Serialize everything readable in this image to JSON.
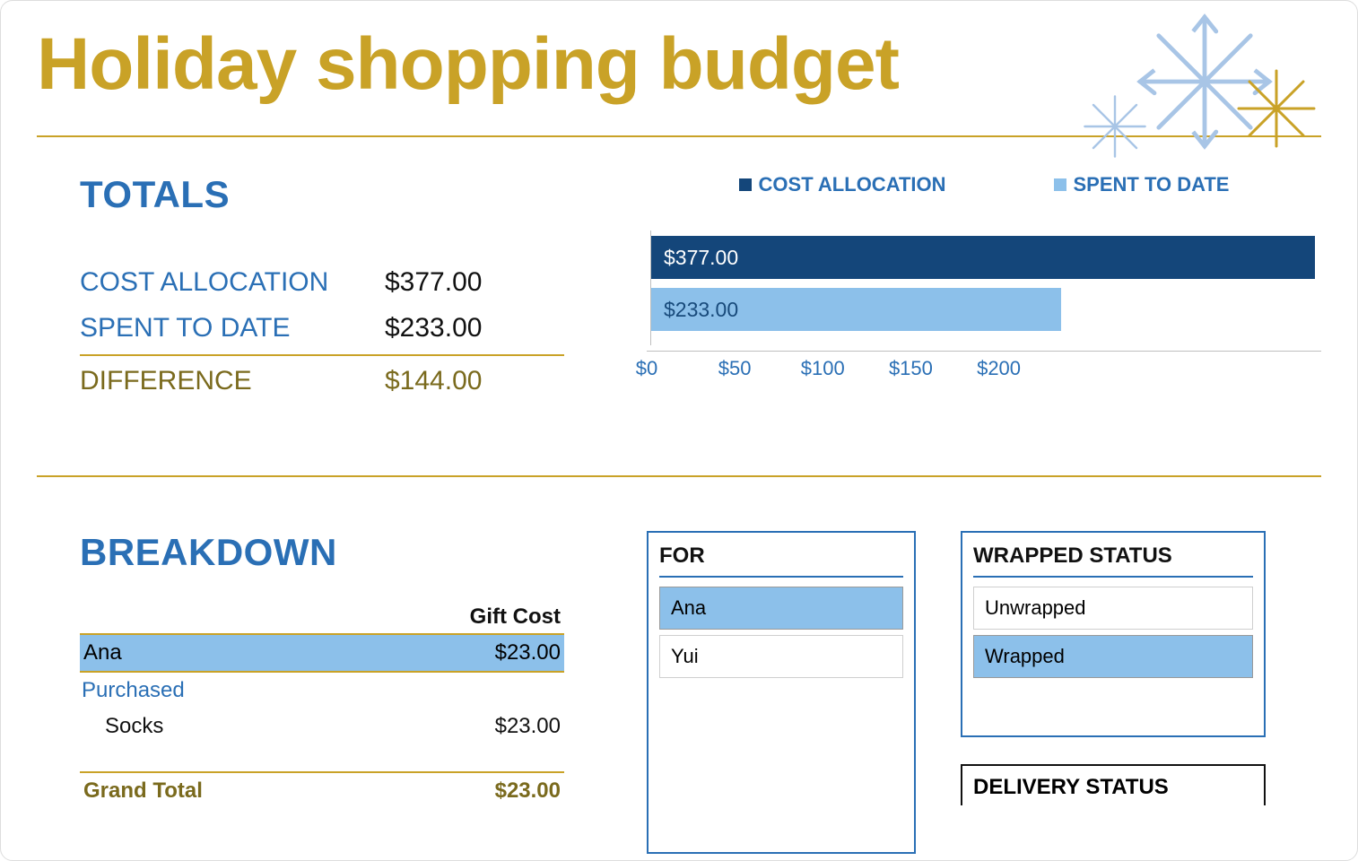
{
  "title": "Holiday shopping budget",
  "colors": {
    "gold": "#c9a227",
    "blue": "#2a6fb5",
    "darkbar": "#14467a",
    "lightbar": "#8cc0ea"
  },
  "totals": {
    "heading": "TOTALS",
    "cost_allocation_label": "COST ALLOCATION",
    "cost_allocation_value": "$377.00",
    "spent_to_date_label": "SPENT TO DATE",
    "spent_to_date_value": "$233.00",
    "difference_label": "DIFFERENCE",
    "difference_value": "$144.00"
  },
  "chart_data": {
    "type": "bar",
    "orientation": "horizontal",
    "series": [
      {
        "name": "COST ALLOCATION",
        "values": [
          377.0
        ],
        "color": "#14467a",
        "label": "$377.00"
      },
      {
        "name": "SPENT TO DATE",
        "values": [
          233.0
        ],
        "color": "#8cc0ea",
        "label": "$233.00"
      }
    ],
    "xlabel": "",
    "ylabel": "",
    "xlim": [
      0,
      377
    ],
    "xticks": [
      0,
      50,
      100,
      150,
      200
    ],
    "xtick_labels": [
      "$0",
      "$50",
      "$100",
      "$150",
      "$200"
    ],
    "legend_position": "top"
  },
  "breakdown": {
    "heading": "BREAKDOWN",
    "column_header": "Gift Cost",
    "person": "Ana",
    "person_total": "$23.00",
    "status_label": "Purchased",
    "item_name": "Socks",
    "item_cost": "$23.00",
    "grand_total_label": "Grand Total",
    "grand_total_value": "$23.00"
  },
  "slicers": {
    "for": {
      "title": "FOR",
      "items": [
        {
          "label": "Ana",
          "selected": true
        },
        {
          "label": "Yui",
          "selected": false
        }
      ]
    },
    "wrapped": {
      "title": "WRAPPED STATUS",
      "items": [
        {
          "label": "Unwrapped",
          "selected": false
        },
        {
          "label": "Wrapped",
          "selected": true
        }
      ]
    },
    "delivery": {
      "title": "DELIVERY STATUS"
    }
  }
}
